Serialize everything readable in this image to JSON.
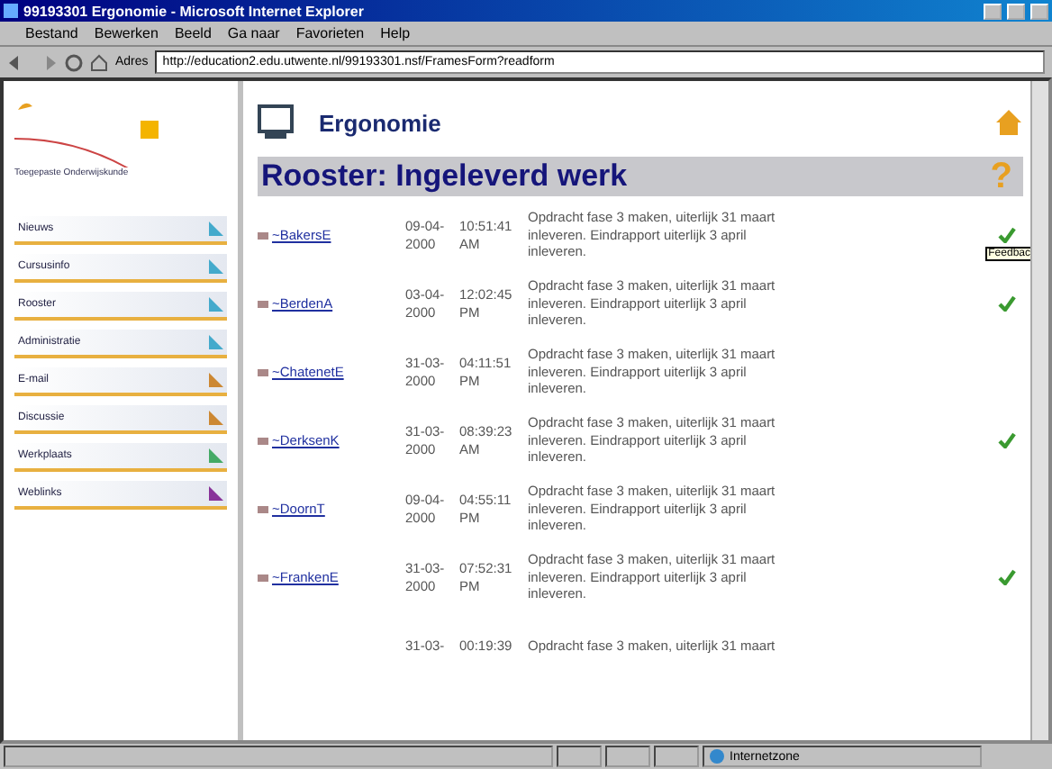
{
  "window": {
    "title": "99193301 Ergonomie - Microsoft Internet Explorer"
  },
  "menu": [
    "Bestand",
    "Bewerken",
    "Beeld",
    "Ga naar",
    "Favorieten",
    "Help"
  ],
  "address": {
    "label": "Adres",
    "value": "http://education2.edu.utwente.nl/99193301.nsf/FramesForm?readform"
  },
  "sidebar": {
    "logo": "Toegepaste Onderwijskunde",
    "items": [
      {
        "label": "Nieuws",
        "color": "#44aacc"
      },
      {
        "label": "Cursusinfo",
        "color": "#44aacc"
      },
      {
        "label": "Rooster",
        "color": "#44aacc"
      },
      {
        "label": "Administratie",
        "color": "#44aacc"
      },
      {
        "label": "E-mail",
        "color": "#cc8833"
      },
      {
        "label": "Discussie",
        "color": "#cc8833"
      },
      {
        "label": "Werkplaats",
        "color": "#44aa66"
      },
      {
        "label": "Weblinks",
        "color": "#883399"
      }
    ]
  },
  "course": "Ergonomie",
  "heading": "Rooster: Ingeleverd werk",
  "help": "?",
  "rows": [
    {
      "name": "~BakersE",
      "date": "09-04-2000",
      "time": "10:51:41 AM",
      "text": "Opdracht fase 3 maken, uiterlijk 31 maart inleveren. Eindrapport uiterlijk 3 april inleveren.",
      "checked": true
    },
    {
      "name": "~BerdenA",
      "date": "03-04-2000",
      "time": "12:02:45 PM",
      "text": "Opdracht fase 3 maken, uiterlijk 31 maart inleveren. Eindrapport uiterlijk 3 april inleveren.",
      "checked": true
    },
    {
      "name": "~ChatenetE",
      "date": "31-03-2000",
      "time": "04:11:51 PM",
      "text": "Opdracht fase 3 maken, uiterlijk 31 maart inleveren. Eindrapport uiterlijk 3 april inleveren.",
      "checked": false
    },
    {
      "name": "~DerksenK",
      "date": "31-03-2000",
      "time": "08:39:23 AM",
      "text": "Opdracht fase 3 maken, uiterlijk 31 maart inleveren. Eindrapport uiterlijk 3 april inleveren.",
      "checked": true
    },
    {
      "name": "~DoornT",
      "date": "09-04-2000",
      "time": "04:55:11 PM",
      "text": "Opdracht fase 3 maken, uiterlijk 31 maart inleveren. Eindrapport uiterlijk 3 april inleveren.",
      "checked": false
    },
    {
      "name": "~FrankenE",
      "date": "31-03-2000",
      "time": "07:52:31 PM",
      "text": "Opdracht fase 3 maken, uiterlijk 31 maart inleveren. Eindrapport uiterlijk 3 april inleveren.",
      "checked": true
    },
    {
      "name": "",
      "date": "31-03-",
      "time": "00:19:39",
      "text": "Opdracht fase 3 maken, uiterlijk 31 maart",
      "checked": false
    }
  ],
  "tooltip": "Feedbac",
  "status": {
    "zone": "Internetzone"
  }
}
